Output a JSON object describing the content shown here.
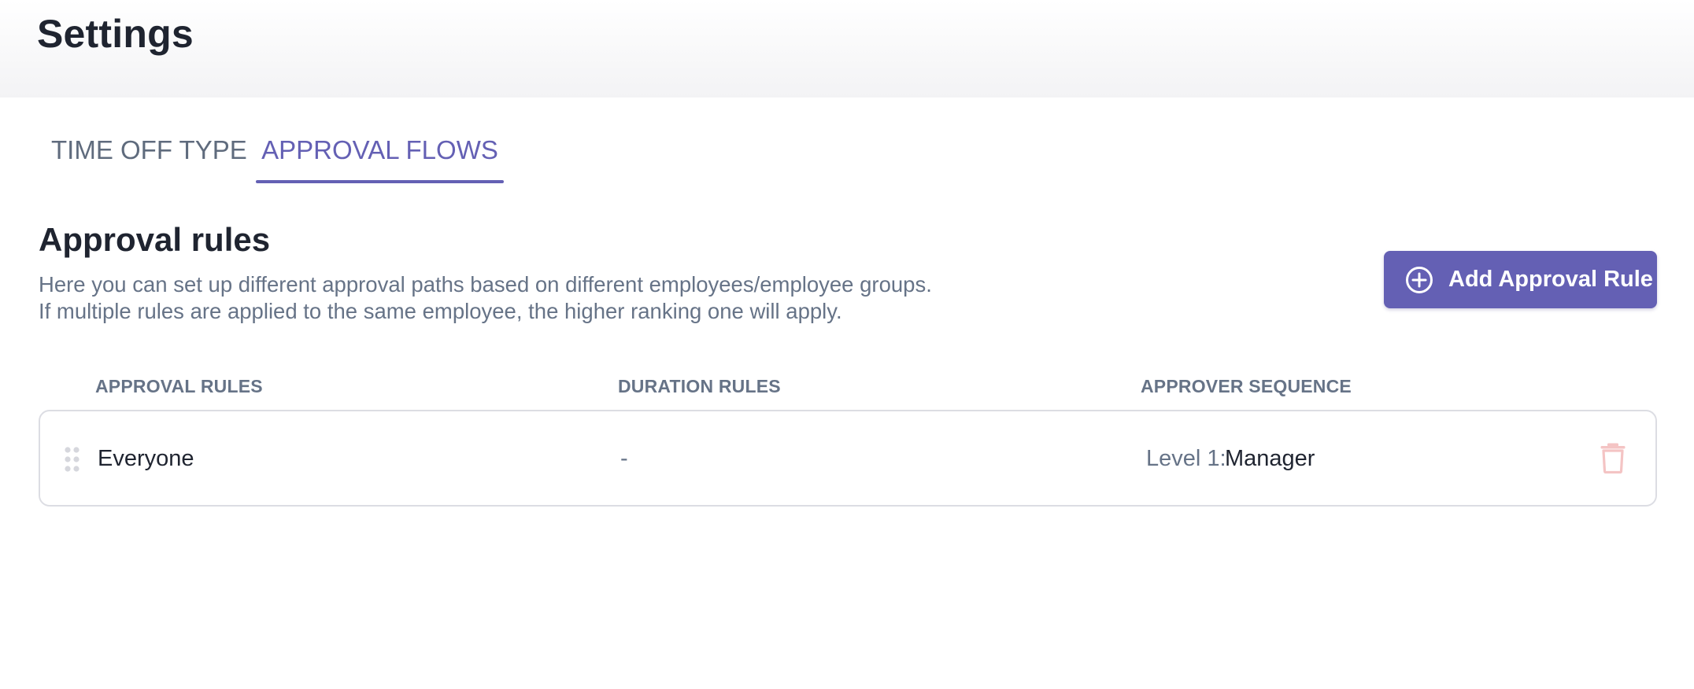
{
  "page": {
    "title": "Settings"
  },
  "tabs": [
    {
      "label": "TIME OFF TYPE",
      "active": false
    },
    {
      "label": "APPROVAL FLOWS",
      "active": true
    }
  ],
  "section": {
    "title": "Approval rules",
    "description_line1": "Here you can set up different approval paths based on different employees/employee groups.",
    "description_line2": "If multiple rules are applied to the same employee, the higher ranking one will apply.",
    "add_button_label": "Add Approval Rule",
    "add_button_icon": "plus-circle-icon"
  },
  "table": {
    "headers": [
      "APPROVAL RULES",
      "DURATION RULES",
      "APPROVER SEQUENCE"
    ],
    "rows": [
      {
        "rule": "Everyone",
        "duration": "-",
        "level_label": "Level 1:",
        "level_value": "Manager",
        "drag_icon": "drag-handle-icon",
        "delete_icon": "trash-icon"
      }
    ]
  },
  "colors": {
    "accent": "#6460b4",
    "muted_text": "#667387",
    "primary_text": "#1f2430",
    "delete_icon": "#f4c4c4",
    "row_border": "#dcdde3"
  }
}
